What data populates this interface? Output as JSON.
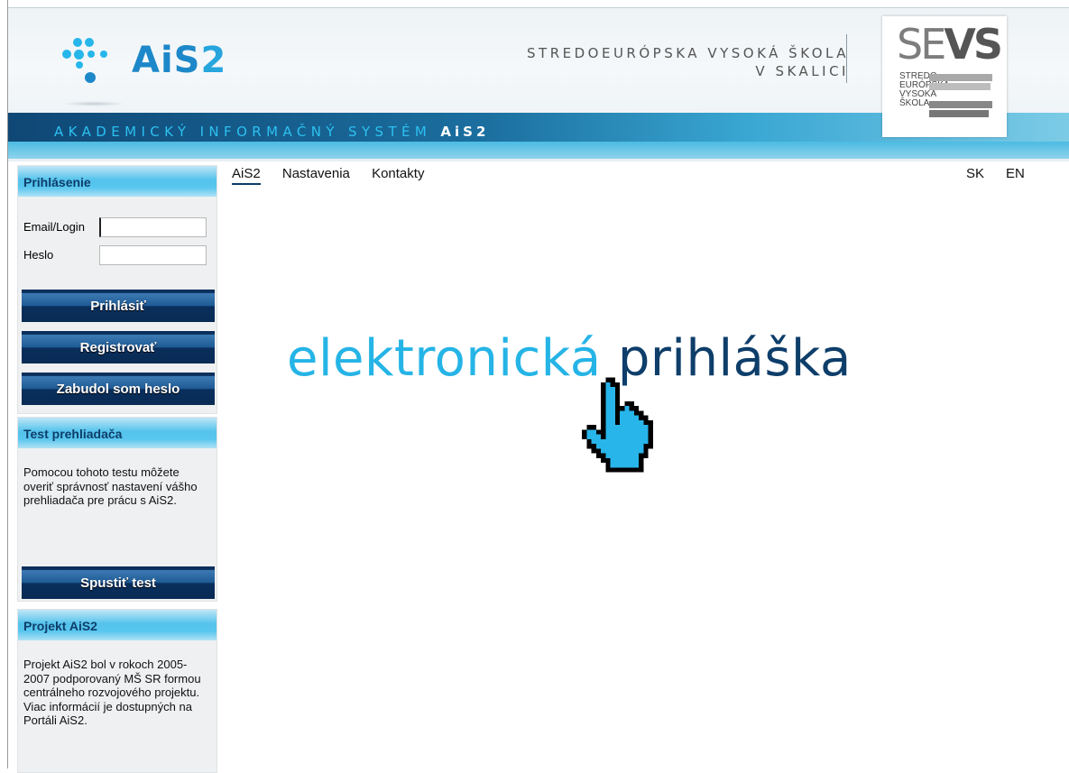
{
  "header": {
    "logo_text": "AiS",
    "logo_text_two": "2",
    "school_line1": "STREDOEURÓPSKA VYSOKÁ ŠKOLA",
    "school_line2": "V SKALICI",
    "sevs_logo": {
      "big_se": "SE",
      "big_vs": "VS",
      "line1": "STREDO",
      "line2": "EURÓPSKA",
      "line3": "VYSOKÁ",
      "line4": "ŠKOLA"
    },
    "bar_text": "AKADEMICKÝ INFORMAČNÝ SYSTÉM",
    "bar_text_ais": "AiS2"
  },
  "nav": {
    "items": [
      {
        "label": "AiS2"
      },
      {
        "label": "Nastavenia"
      },
      {
        "label": "Kontakty"
      }
    ],
    "lang_sk": "SK",
    "lang_en": "EN"
  },
  "login": {
    "title": "Prihlásenie",
    "email_label": "Email/Login",
    "email_value": "",
    "password_label": "Heslo",
    "password_value": "",
    "login_button": "Prihlásiť",
    "register_button": "Registrovať",
    "forgot_button": "Zabudol som heslo"
  },
  "browser_test": {
    "title": "Test prehliadača",
    "text": "Pomocou tohoto testu môžete overiť správnosť nastavení vášho prehliadača pre prácu s AiS2.",
    "button": "Spustiť test"
  },
  "project": {
    "title": "Projekt AiS2",
    "text": "Projekt AiS2 bol v rokoch 2005-2007 podporovaný MŠ SR formou centrálneho rozvojového projektu. Viac informácií je dostupných na Portáli AiS2."
  },
  "hero": {
    "word1": "elektronická",
    "word2": "prihláška"
  },
  "colors": {
    "accent_light": "#25b4e6",
    "accent_dark": "#0e3e6a",
    "button_dark": "#0a2f5c"
  },
  "icons": {
    "hero_cursor": "hand-pointer-icon"
  }
}
